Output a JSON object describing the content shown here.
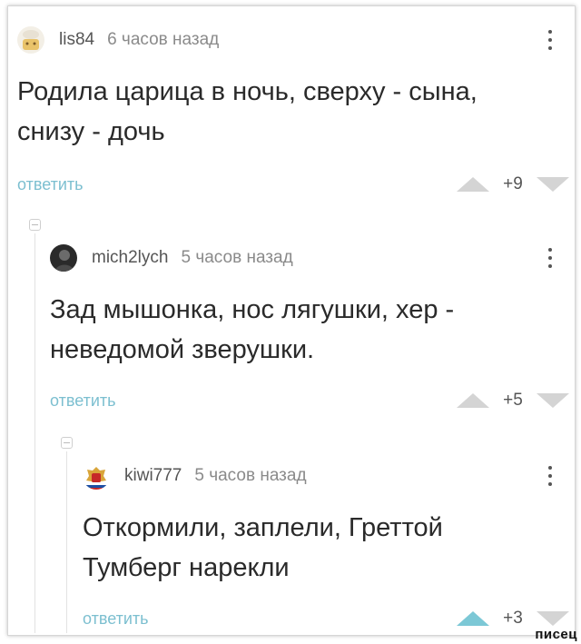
{
  "comments": [
    {
      "username": "lis84",
      "timestamp": "6 часов назад",
      "text_line1": "Родила царица в ночь, сверху - сына,",
      "text_line2": "снизу - дочь",
      "reply_label": "ответить",
      "score": "+9",
      "upvoted": false
    },
    {
      "username": "mich2lych",
      "timestamp": "5 часов назад",
      "text_line1": "Зад мышонка, нос лягушки, хер -",
      "text_line2": "неведомой зверушки.",
      "reply_label": "ответить",
      "score": "+5",
      "upvoted": false
    },
    {
      "username": "kiwi777",
      "timestamp": "5 часов назад",
      "text_line1": "Откормили, заплели, Греттой",
      "text_line2": "Тумберг нарекли",
      "reply_label": "ответить",
      "score": "+3",
      "upvoted": true
    }
  ],
  "watermark": "писец",
  "colors": {
    "reply_link": "#7cbfd0",
    "upvote_active": "#7cc8d6",
    "vote_inactive": "#d4d4d4"
  }
}
